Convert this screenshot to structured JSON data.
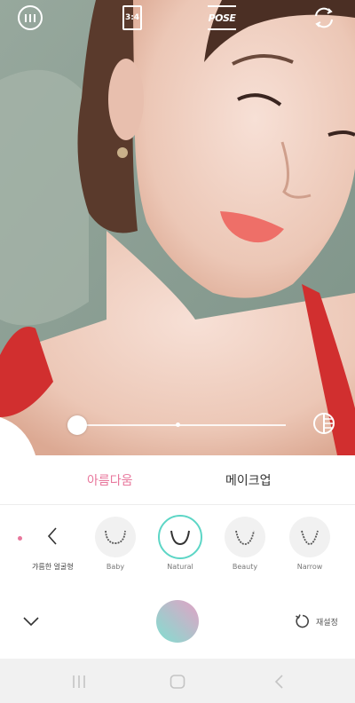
{
  "top_bar": {
    "ratio_label": "3:4",
    "pose_label": "POSE"
  },
  "tabs": {
    "beauty_label": "아름다움",
    "makeup_label": "메이크업"
  },
  "options": {
    "category_label": "갸름한 얼굴형",
    "face_shapes": [
      {
        "label": "Baby"
      },
      {
        "label": "Natural"
      },
      {
        "label": "Beauty"
      },
      {
        "label": "Narrow"
      }
    ],
    "selected": "Natural"
  },
  "actions": {
    "reset_label": "재설정"
  },
  "slider": {
    "value": 0
  },
  "colors": {
    "accent_pink": "#e8779c",
    "accent_teal": "#5dd6c6"
  }
}
